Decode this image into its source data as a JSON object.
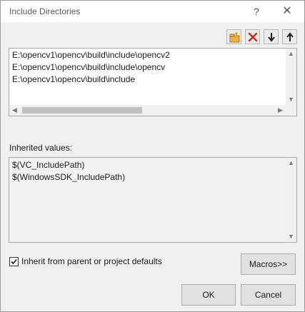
{
  "window": {
    "title": "Include Directories",
    "help_glyph": "?",
    "close_glyph": "✕"
  },
  "toolbar": {
    "buttons": [
      {
        "name": "new-line",
        "icon": "new-folder-icon"
      },
      {
        "name": "delete",
        "icon": "delete-x-icon"
      },
      {
        "name": "move-down",
        "icon": "arrow-down-icon"
      },
      {
        "name": "move-up",
        "icon": "arrow-up-icon"
      }
    ]
  },
  "directories": {
    "lines": [
      "E:\\opencv1\\opencv\\build\\include\\opencv2",
      "E:\\opencv1\\opencv\\build\\include\\opencv",
      "E:\\opencv1\\opencv\\build\\include"
    ]
  },
  "inherited": {
    "label": "Inherited values:",
    "lines": [
      "$(VC_IncludePath)",
      "$(WindowsSDK_IncludePath)"
    ]
  },
  "options": {
    "inherit_label": "Inherit from parent or project defaults",
    "inherit_checked": true
  },
  "buttons": {
    "macros": "Macros>>",
    "ok": "OK",
    "cancel": "Cancel"
  },
  "colors": {
    "delete_red": "#c42b1c",
    "folder_yellow": "#e8b23c"
  }
}
